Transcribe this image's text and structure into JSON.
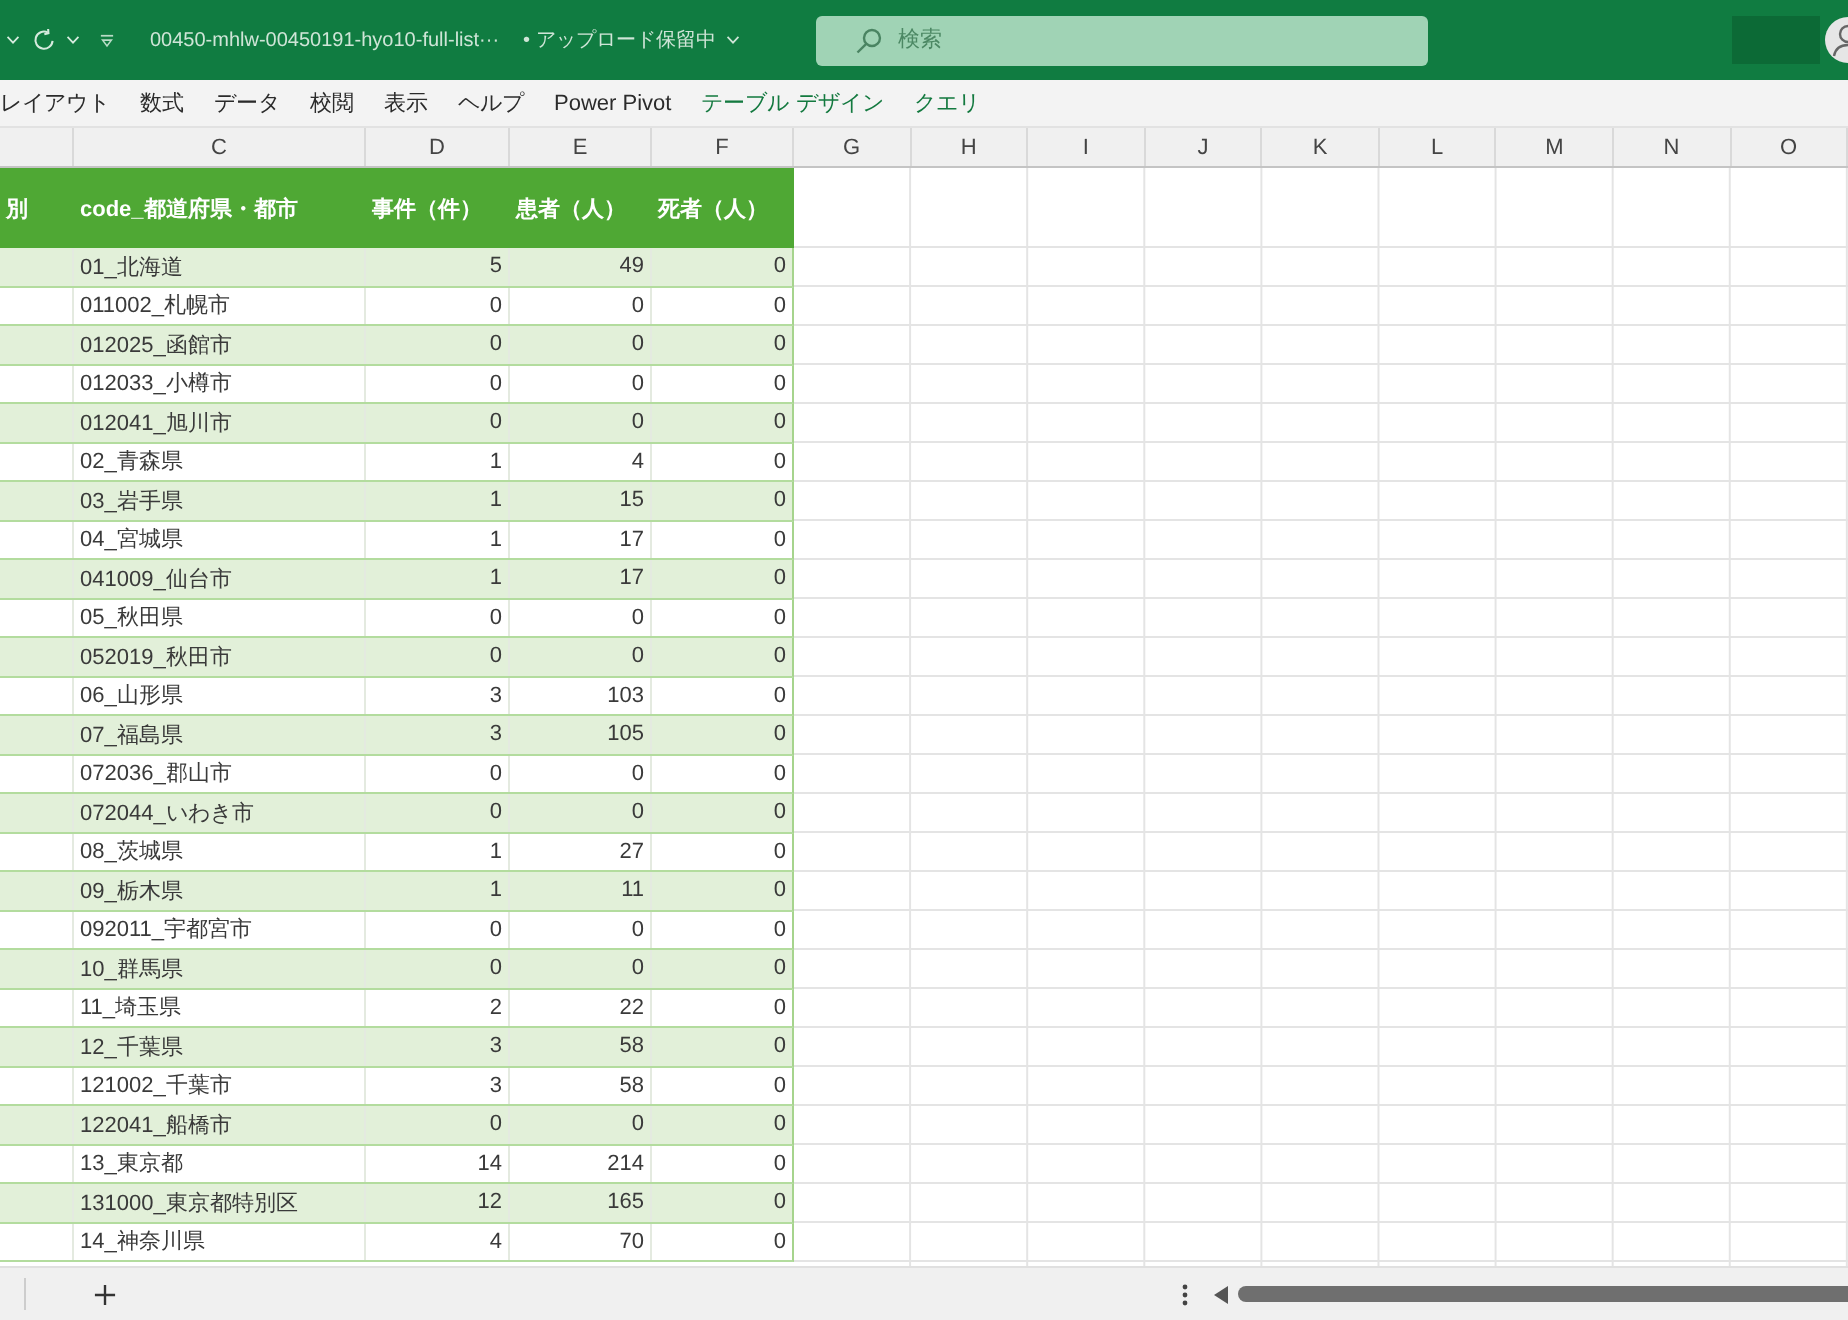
{
  "title_bar": {
    "file_name": "00450-mhlw-00450191-hyo10-full-list···",
    "save_status": "• アップロード保留中",
    "search": {
      "placeholder": "検索"
    }
  },
  "ribbon_tabs": [
    {
      "label": "レイアウト",
      "kind": "standard"
    },
    {
      "label": "数式",
      "kind": "standard"
    },
    {
      "label": "データ",
      "kind": "standard"
    },
    {
      "label": "校閲",
      "kind": "standard"
    },
    {
      "label": "表示",
      "kind": "standard"
    },
    {
      "label": "ヘルプ",
      "kind": "standard"
    },
    {
      "label": "Power Pivot",
      "kind": "standard"
    },
    {
      "label": "テーブル デザイン",
      "kind": "contextual"
    },
    {
      "label": "クエリ",
      "kind": "contextual"
    }
  ],
  "sheet": {
    "column_letters": [
      "C",
      "D",
      "E",
      "F",
      "G",
      "H",
      "I",
      "J",
      "K",
      "L",
      "M",
      "N",
      "O"
    ],
    "table": {
      "columns": [
        "別",
        "code_都道府県・都市",
        "事件（件）",
        "患者（人）",
        "死者（人）"
      ],
      "rows": [
        [
          "",
          "01_北海道",
          "5",
          "49",
          "0"
        ],
        [
          "",
          "011002_札幌市",
          "0",
          "0",
          "0"
        ],
        [
          "",
          "012025_函館市",
          "0",
          "0",
          "0"
        ],
        [
          "",
          "012033_小樽市",
          "0",
          "0",
          "0"
        ],
        [
          "",
          "012041_旭川市",
          "0",
          "0",
          "0"
        ],
        [
          "",
          "02_青森県",
          "1",
          "4",
          "0"
        ],
        [
          "",
          "03_岩手県",
          "1",
          "15",
          "0"
        ],
        [
          "",
          "04_宮城県",
          "1",
          "17",
          "0"
        ],
        [
          "",
          "041009_仙台市",
          "1",
          "17",
          "0"
        ],
        [
          "",
          "05_秋田県",
          "0",
          "0",
          "0"
        ],
        [
          "",
          "052019_秋田市",
          "0",
          "0",
          "0"
        ],
        [
          "",
          "06_山形県",
          "3",
          "103",
          "0"
        ],
        [
          "",
          "07_福島県",
          "3",
          "105",
          "0"
        ],
        [
          "",
          "072036_郡山市",
          "0",
          "0",
          "0"
        ],
        [
          "",
          "072044_いわき市",
          "0",
          "0",
          "0"
        ],
        [
          "",
          "08_茨城県",
          "1",
          "27",
          "0"
        ],
        [
          "",
          "09_栃木県",
          "1",
          "11",
          "0"
        ],
        [
          "",
          "092011_宇都宮市",
          "0",
          "0",
          "0"
        ],
        [
          "",
          "10_群馬県",
          "0",
          "0",
          "0"
        ],
        [
          "",
          "11_埼玉県",
          "2",
          "22",
          "0"
        ],
        [
          "",
          "12_千葉県",
          "3",
          "58",
          "0"
        ],
        [
          "",
          "121002_千葉市",
          "3",
          "58",
          "0"
        ],
        [
          "",
          "122041_船橋市",
          "0",
          "0",
          "0"
        ],
        [
          "",
          "13_東京都",
          "14",
          "214",
          "0"
        ],
        [
          "",
          "131000_東京都特別区",
          "12",
          "165",
          "0"
        ],
        [
          "",
          "14_神奈川県",
          "4",
          "70",
          "0"
        ]
      ]
    }
  }
}
